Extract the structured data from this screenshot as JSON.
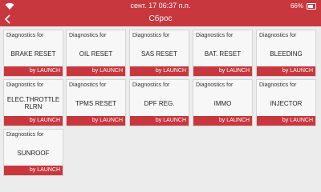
{
  "status_bar": {
    "time": "сент. 17 06:37 п.п.",
    "battery": "66%"
  },
  "header": {
    "title": "Сброс"
  },
  "card_prefix": "Diagnostics for",
  "card_footer": "by LAUNCH",
  "cards": [
    {
      "label": "BRAKE RESET"
    },
    {
      "label": "OIL RESET"
    },
    {
      "label": "SAS RESET"
    },
    {
      "label": "BAT. RESET"
    },
    {
      "label": "BLEEDING"
    },
    {
      "label": "ELEC.THROTTLE RLRN"
    },
    {
      "label": "TPMS RESET"
    },
    {
      "label": "DPF REG."
    },
    {
      "label": "IMMO"
    },
    {
      "label": "INJECTOR"
    },
    {
      "label": "SUNROOF"
    }
  ]
}
